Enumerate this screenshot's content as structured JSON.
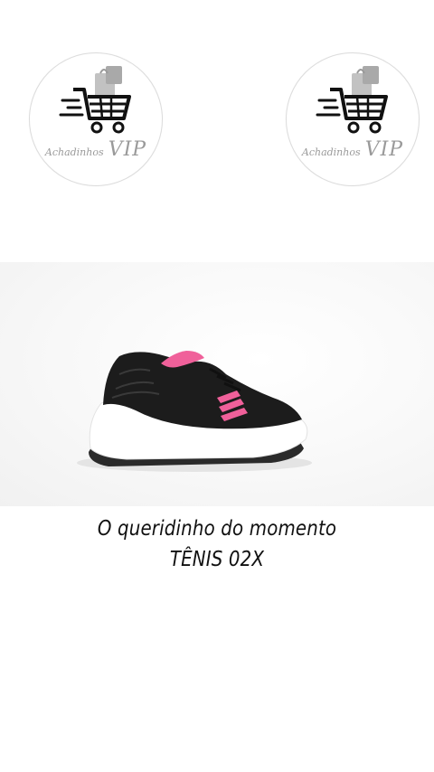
{
  "watermark": {
    "brand_prefix": "Achadinhos",
    "brand_suffix": "VIP",
    "icon": "shopping-cart-icon",
    "icon_color": "#111111",
    "bag_color": "#b5b5b5"
  },
  "product_photo": {
    "subject": "sneaker-image",
    "shoe_color": "#1c1c1c",
    "accent_color": "#f0609a",
    "sole_color": "#ffffff"
  },
  "caption": {
    "line1": "O queridinho do momento",
    "line2": "TÊNIS 02X"
  }
}
